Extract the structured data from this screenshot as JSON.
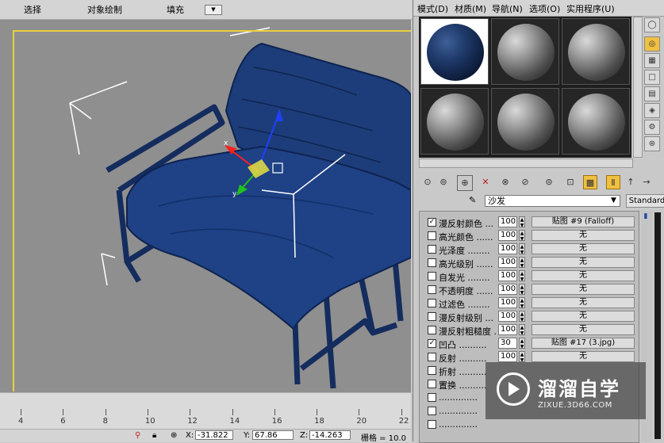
{
  "toolbar": {
    "select": "选择",
    "object_paint": "对象绘制",
    "fill": "填充"
  },
  "ruler": {
    "ticks": [
      "4",
      "6",
      "8",
      "10",
      "12",
      "14",
      "16",
      "18",
      "20",
      "22"
    ]
  },
  "status": {
    "x_label": "X:",
    "x_value": "-31.822",
    "y_label": "Y:",
    "y_value": "67.86",
    "z_label": "Z:",
    "z_value": "-14.263",
    "grid": "栅格 = 10.0"
  },
  "material_editor": {
    "menu": [
      "模式(D)",
      "材质(M)",
      "导航(N)",
      "选项(O)",
      "实用程序(U)"
    ],
    "material_name": "沙发",
    "material_type": "Standard",
    "maps": [
      {
        "checked": true,
        "label": "漫反射颜色 ...",
        "amount": "100",
        "map": "贴图 #9 (Falloff)"
      },
      {
        "checked": false,
        "label": "高光颜色 ......",
        "amount": "100",
        "map": "无"
      },
      {
        "checked": false,
        "label": "光泽度 ........",
        "amount": "100",
        "map": "无"
      },
      {
        "checked": false,
        "label": "高光级别 ......",
        "amount": "100",
        "map": "无"
      },
      {
        "checked": false,
        "label": "自发光 ........",
        "amount": "100",
        "map": "无"
      },
      {
        "checked": false,
        "label": "不透明度 ......",
        "amount": "100",
        "map": "无"
      },
      {
        "checked": false,
        "label": "过滤色 ........",
        "amount": "100",
        "map": "无"
      },
      {
        "checked": false,
        "label": "漫反射级别 ...",
        "amount": "100",
        "map": "无"
      },
      {
        "checked": false,
        "label": "漫反射粗糙度 .",
        "amount": "100",
        "map": "无"
      },
      {
        "checked": true,
        "label": "凹凸 ..........",
        "amount": "30",
        "map": "贴图 #17 (3.jpg)"
      },
      {
        "checked": false,
        "label": "反射 ..........",
        "amount": "100",
        "map": "无"
      },
      {
        "checked": false,
        "label": "折射 ..........",
        "amount": "",
        "map": ""
      },
      {
        "checked": false,
        "label": "置换 ..........",
        "amount": "",
        "map": ""
      },
      {
        "checked": false,
        "label": "..............",
        "amount": "",
        "map": ""
      },
      {
        "checked": false,
        "label": "..............",
        "amount": "",
        "map": ""
      },
      {
        "checked": false,
        "label": "..............",
        "amount": "",
        "map": ""
      }
    ]
  },
  "watermark": {
    "title": "溜溜自学",
    "url": "ZIXUE.3D66.COM"
  },
  "colors": {
    "viewport_bg": "#8f8f8f",
    "active_border": "#e8d23a",
    "sofa_blue": "#1c3c78",
    "frame_blue": "#142c5e"
  }
}
